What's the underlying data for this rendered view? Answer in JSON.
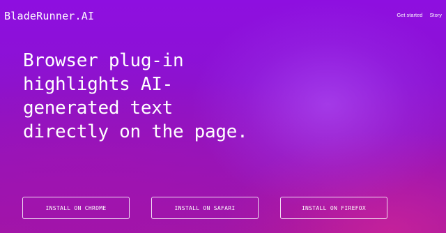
{
  "header": {
    "brand": "BladeRunner.AI",
    "nav": [
      {
        "label": "Get started"
      },
      {
        "label": "Story"
      }
    ]
  },
  "hero": {
    "lines": [
      "Browser plug-in",
      "highlights AI-",
      "generated text",
      "directly on the page."
    ]
  },
  "buttons": {
    "chrome": "INSTALL ON CHROME",
    "safari": "INSTALL ON SAFARI",
    "firefox": "INSTALL ON FIREFOX"
  },
  "colors": {
    "background_top": "#8e0fe0",
    "background_bottom": "#a6189f",
    "text": "#ffffff"
  }
}
